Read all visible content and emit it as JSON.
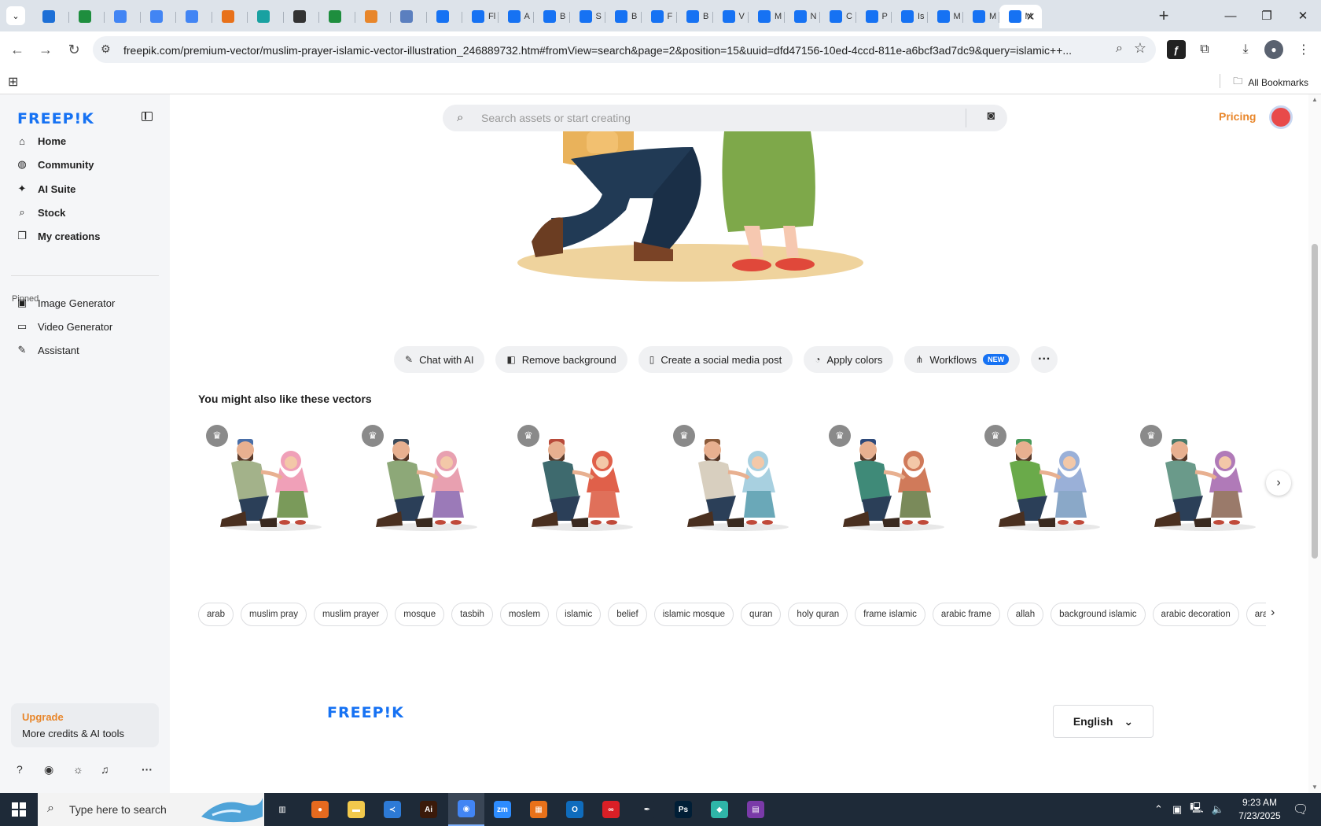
{
  "browser": {
    "tabs": [
      {
        "fav_color": "#1d6fd6",
        "icon": "globe-icon",
        "label": ""
      },
      {
        "fav_color": "#1e8e3e",
        "icon": "sheets-icon",
        "label": ""
      },
      {
        "fav_color": "#4285f4",
        "icon": "docs-icon",
        "label": ""
      },
      {
        "fav_color": "#4285f4",
        "icon": "docs-icon",
        "label": ""
      },
      {
        "fav_color": "#4285f4",
        "icon": "docs-icon",
        "label": ""
      },
      {
        "fav_color": "#e8711a",
        "icon": "app-icon",
        "label": ""
      },
      {
        "fav_color": "#19a1a1",
        "icon": "app-icon",
        "label": ""
      },
      {
        "fav_color": "#333333",
        "icon": "openai-icon",
        "label": ""
      },
      {
        "fav_color": "#1e8e3e",
        "icon": "sheets-icon",
        "label": ""
      },
      {
        "fav_color": "#e8862a",
        "icon": "app-icon",
        "label": ""
      },
      {
        "fav_color": "#5b7fbf",
        "icon": "app-icon",
        "label": ""
      },
      {
        "fav_color": "#1672f3",
        "icon": "freepik-icon",
        "label": ""
      },
      {
        "fav_color": "#1672f3",
        "icon": "freepik-icon",
        "label": "Fl"
      },
      {
        "fav_color": "#1672f3",
        "icon": "freepik-icon",
        "label": "A"
      },
      {
        "fav_color": "#1672f3",
        "icon": "freepik-icon",
        "label": "B"
      },
      {
        "fav_color": "#1672f3",
        "icon": "freepik-icon",
        "label": "S"
      },
      {
        "fav_color": "#1672f3",
        "icon": "freepik-icon",
        "label": "B"
      },
      {
        "fav_color": "#1672f3",
        "icon": "freepik-icon",
        "label": "F"
      },
      {
        "fav_color": "#1672f3",
        "icon": "freepik-icon",
        "label": "B"
      },
      {
        "fav_color": "#1672f3",
        "icon": "freepik-icon",
        "label": "V"
      },
      {
        "fav_color": "#1672f3",
        "icon": "freepik-icon",
        "label": "M"
      },
      {
        "fav_color": "#1672f3",
        "icon": "freepik-icon",
        "label": "N"
      },
      {
        "fav_color": "#1672f3",
        "icon": "freepik-icon",
        "label": "C"
      },
      {
        "fav_color": "#1672f3",
        "icon": "freepik-icon",
        "label": "P"
      },
      {
        "fav_color": "#1672f3",
        "icon": "freepik-icon",
        "label": "Is"
      },
      {
        "fav_color": "#1672f3",
        "icon": "freepik-icon",
        "label": "M"
      },
      {
        "fav_color": "#1672f3",
        "icon": "freepik-icon",
        "label": "M"
      }
    ],
    "active_tab_label": "M",
    "url": "freepik.com/premium-vector/muslim-prayer-islamic-vector-illustration_246889732.htm#fromView=search&page=2&position=15&uuid=dfd47156-10ed-4ccd-811e-a6bcf3ad7dc9&query=islamic++...",
    "all_bookmarks": "All Bookmarks"
  },
  "sidebar": {
    "logo": "FREEP!K",
    "nav": [
      {
        "label": "Home",
        "icon": "home-icon",
        "glyph": "⌂"
      },
      {
        "label": "Community",
        "icon": "globe-icon",
        "glyph": "◍"
      },
      {
        "label": "AI Suite",
        "icon": "sparkle-icon",
        "glyph": "✦"
      },
      {
        "label": "Stock",
        "icon": "search-icon",
        "glyph": "⌕"
      },
      {
        "label": "My creations",
        "icon": "layers-icon",
        "glyph": "❐"
      }
    ],
    "pinned_label": "Pinned",
    "pinned": [
      {
        "label": "Image Generator",
        "icon": "image-icon",
        "glyph": "▣"
      },
      {
        "label": "Video Generator",
        "icon": "video-icon",
        "glyph": "▭"
      },
      {
        "label": "Assistant",
        "icon": "assistant-icon",
        "glyph": "✎"
      }
    ],
    "upgrade": {
      "title": "Upgrade",
      "subtitle": "More credits & AI tools"
    }
  },
  "header": {
    "search_placeholder": "Search assets or start creating",
    "pricing": "Pricing"
  },
  "actions": [
    {
      "label": "Chat with AI",
      "icon": "chat-ai-icon",
      "glyph": "✎"
    },
    {
      "label": "Remove background",
      "icon": "remove-bg-icon",
      "glyph": "◧"
    },
    {
      "label": "Create a social media post",
      "icon": "phone-icon",
      "glyph": "▯"
    },
    {
      "label": "Apply colors",
      "icon": "palette-icon",
      "glyph": "◔"
    },
    {
      "label": "Workflows",
      "icon": "workflow-icon",
      "glyph": "⋔",
      "badge": "NEW"
    }
  ],
  "related": {
    "title": "You might also like these vectors",
    "items": [
      {
        "shirt": "#a3b28a",
        "hijab": "#f0a0b8",
        "dress": "#7a9a5a",
        "cap": "#4a6fa8"
      },
      {
        "shirt": "#8da878",
        "hijab": "#e8a0b0",
        "dress": "#9b7ab8",
        "cap": "#3b4a5a"
      },
      {
        "shirt": "#3e6a6e",
        "hijab": "#e0604a",
        "dress": "#e0705a",
        "cap": "#b84a3a"
      },
      {
        "shirt": "#d8cfbf",
        "hijab": "#a8d0e0",
        "dress": "#6aa8b8",
        "cap": "#8a5a3a"
      },
      {
        "shirt": "#3f8a78",
        "hijab": "#d07a5a",
        "dress": "#7a8a5a",
        "cap": "#2f4a7a"
      },
      {
        "shirt": "#6aaa4a",
        "hijab": "#9ab0d8",
        "dress": "#8aa8c8",
        "cap": "#4a9a5a"
      },
      {
        "shirt": "#6a9a8a",
        "hijab": "#b07ab8",
        "dress": "#9a7a6a",
        "cap": "#4a7a6a"
      }
    ]
  },
  "tags": [
    "arab",
    "muslim pray",
    "muslim prayer",
    "mosque",
    "tasbih",
    "moslem",
    "islamic",
    "belief",
    "islamic mosque",
    "quran",
    "holy quran",
    "frame islamic",
    "arabic frame",
    "allah",
    "background islamic",
    "arabic decoration",
    "arabic o"
  ],
  "footer": {
    "logo": "FREEP!K",
    "language": "English"
  },
  "taskbar": {
    "search_placeholder": "Type here to search",
    "apps": [
      {
        "name": "task-view-icon",
        "color": "#1e2a38",
        "text": "▥"
      },
      {
        "name": "firefox-icon",
        "color": "#e66a1f",
        "text": "●"
      },
      {
        "name": "file-explorer-icon",
        "color": "#f2c94c",
        "text": "▬"
      },
      {
        "name": "vscode-icon",
        "color": "#2d7ad6",
        "text": "≺"
      },
      {
        "name": "illustrator-icon",
        "color": "#3a1a0a",
        "text": "Ai"
      },
      {
        "name": "chrome-icon",
        "color": "#4285f4",
        "text": "◉"
      },
      {
        "name": "zoom-icon",
        "color": "#2d8cff",
        "text": "zm"
      },
      {
        "name": "app-orange-icon",
        "color": "#e8711a",
        "text": "▦"
      },
      {
        "name": "outlook-icon",
        "color": "#0f6cbd",
        "text": "O"
      },
      {
        "name": "creative-cloud-icon",
        "color": "#da1f26",
        "text": "∞"
      },
      {
        "name": "pen-tool-icon",
        "color": "#1e2a38",
        "text": "✒"
      },
      {
        "name": "photoshop-icon",
        "color": "#001e36",
        "text": "Ps"
      },
      {
        "name": "app-teal-icon",
        "color": "#2fb5a8",
        "text": "◆"
      },
      {
        "name": "winrar-icon",
        "color": "#7a3aa8",
        "text": "▤"
      }
    ],
    "time": "9:23 AM",
    "date": "7/23/2025"
  }
}
